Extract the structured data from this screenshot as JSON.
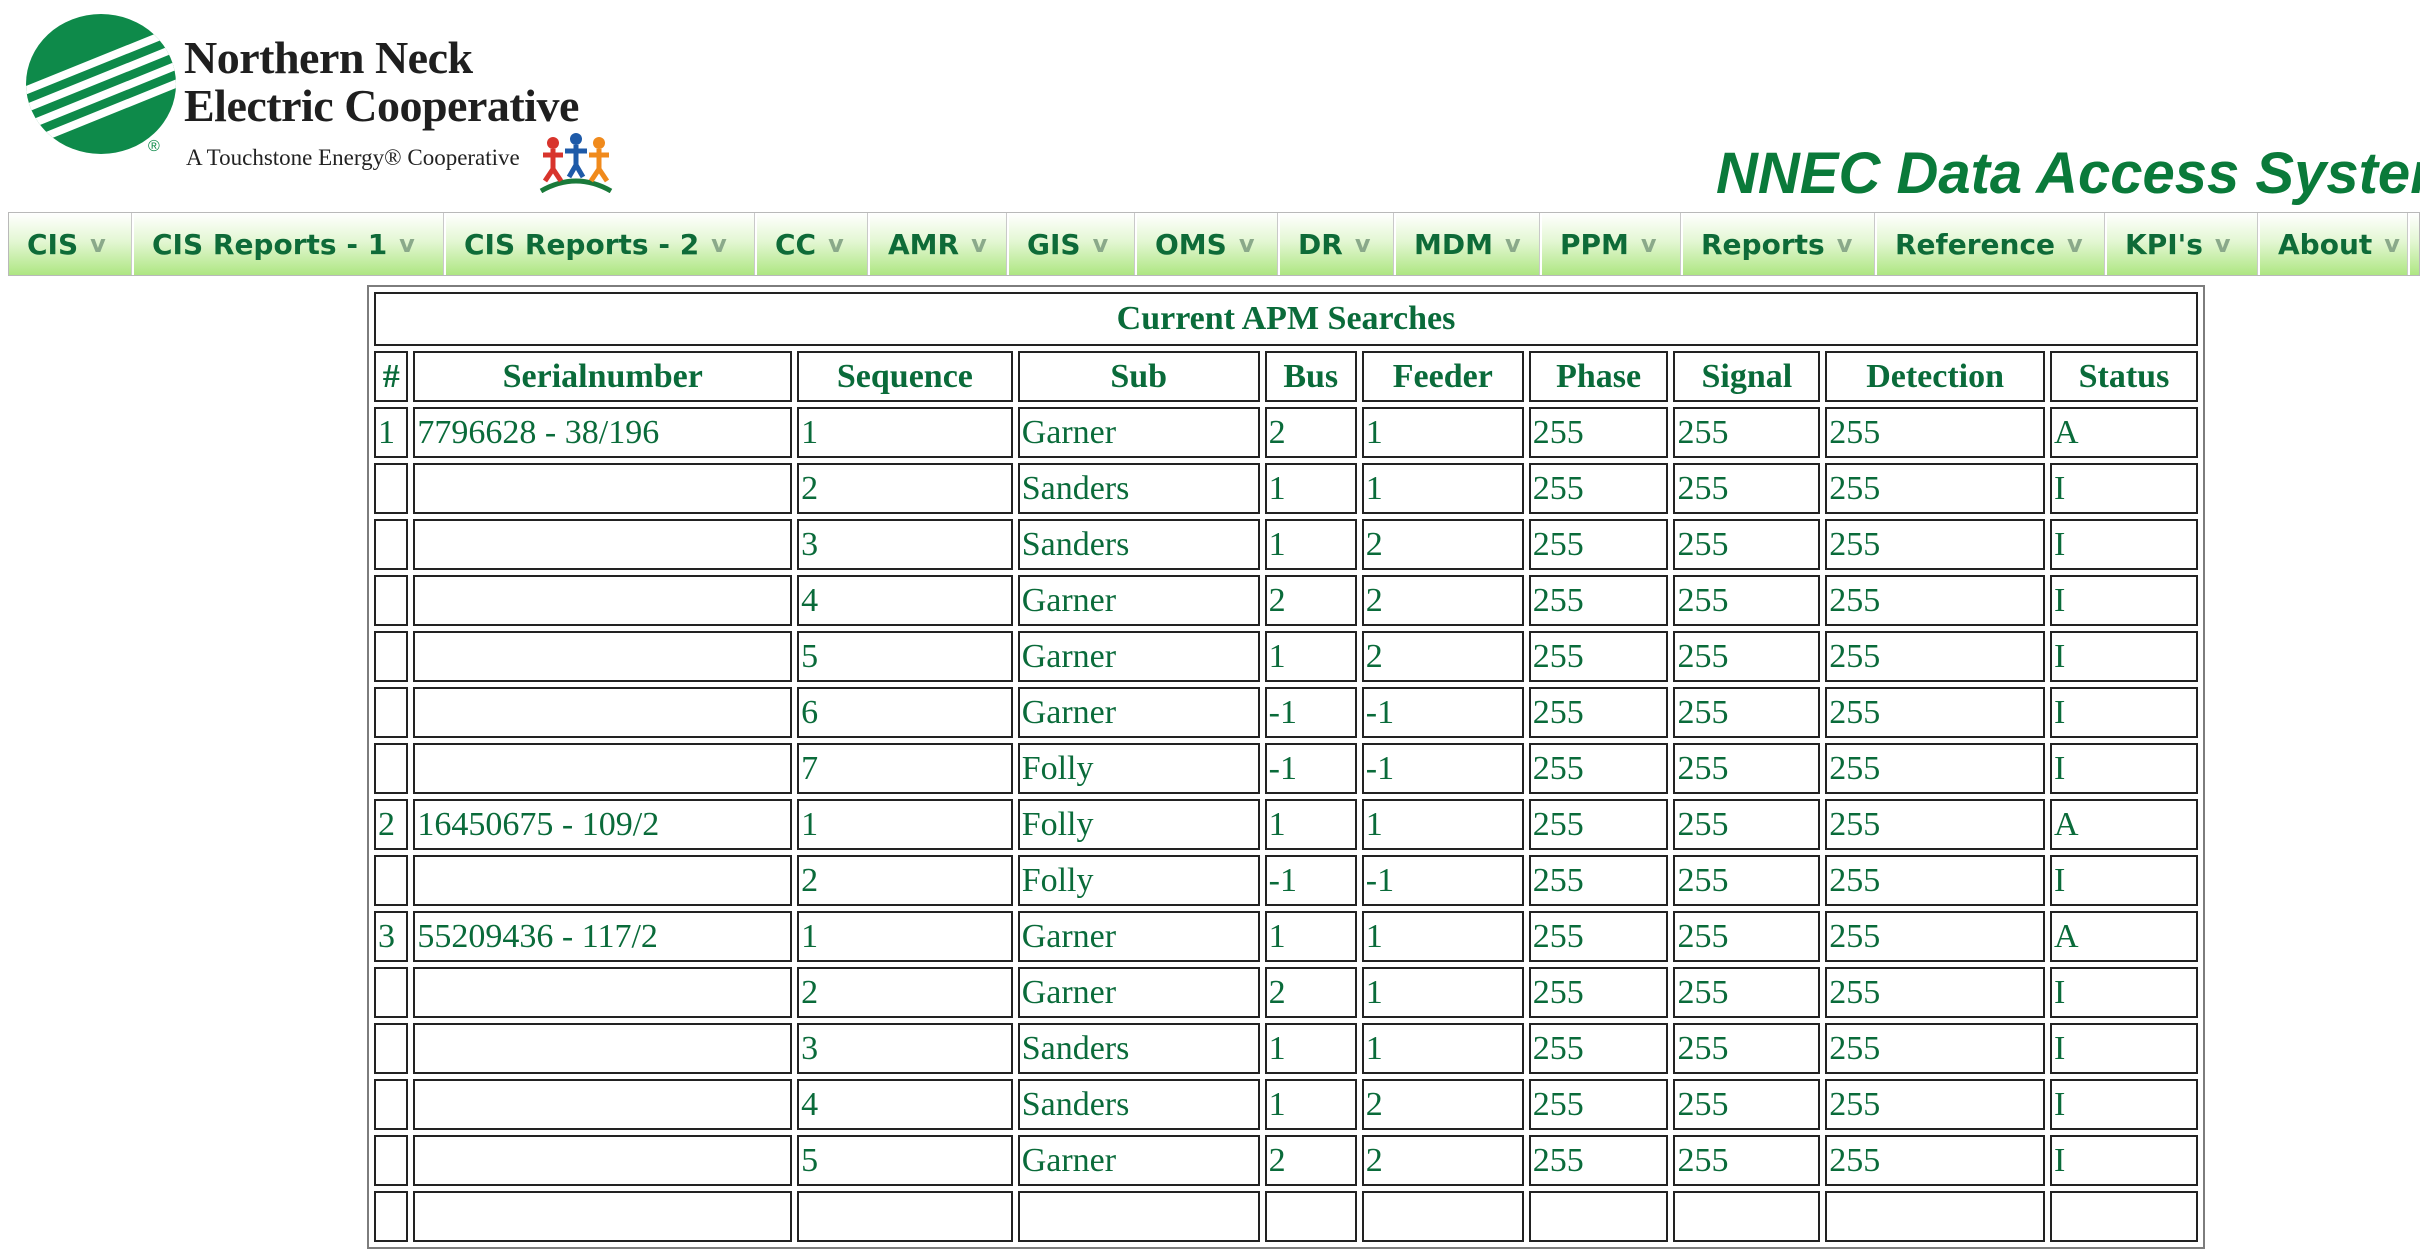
{
  "logo": {
    "name_line1": "Northern Neck",
    "name_line2": "Electric Cooperative",
    "tagline": "A Touchstone Energy® Cooperative",
    "registered_mark": "®",
    "brand_color": "#0e8a4a"
  },
  "app_title": "NNEC Data Access System",
  "menu": {
    "items": [
      {
        "label": "CIS",
        "caret": "v"
      },
      {
        "label": "CIS Reports - 1",
        "caret": "v"
      },
      {
        "label": "CIS Reports - 2",
        "caret": "v"
      },
      {
        "label": "CC",
        "caret": "v"
      },
      {
        "label": "AMR",
        "caret": "v"
      },
      {
        "label": "GIS",
        "caret": "v"
      },
      {
        "label": "OMS",
        "caret": "v"
      },
      {
        "label": "DR",
        "caret": "v"
      },
      {
        "label": "MDM",
        "caret": "v"
      },
      {
        "label": "PPM",
        "caret": "v"
      },
      {
        "label": "Reports",
        "caret": "v"
      },
      {
        "label": "Reference",
        "caret": "v"
      },
      {
        "label": "KPI's",
        "caret": "v"
      },
      {
        "label": "About",
        "caret": "v"
      }
    ]
  },
  "table": {
    "title": "Current APM Searches",
    "columns": [
      "#",
      "Serialnumber",
      "Sequence",
      "Sub",
      "Bus",
      "Feeder",
      "Phase",
      "Signal",
      "Detection",
      "Status"
    ],
    "rows": [
      [
        "1",
        "7796628 - 38/196",
        "1",
        "Garner",
        "2",
        "1",
        "255",
        "255",
        "255",
        "A"
      ],
      [
        "",
        "",
        "2",
        "Sanders",
        "1",
        "1",
        "255",
        "255",
        "255",
        "I"
      ],
      [
        "",
        "",
        "3",
        "Sanders",
        "1",
        "2",
        "255",
        "255",
        "255",
        "I"
      ],
      [
        "",
        "",
        "4",
        "Garner",
        "2",
        "2",
        "255",
        "255",
        "255",
        "I"
      ],
      [
        "",
        "",
        "5",
        "Garner",
        "1",
        "2",
        "255",
        "255",
        "255",
        "I"
      ],
      [
        "",
        "",
        "6",
        "Garner",
        "-1",
        "-1",
        "255",
        "255",
        "255",
        "I"
      ],
      [
        "",
        "",
        "7",
        "Folly",
        "-1",
        "-1",
        "255",
        "255",
        "255",
        "I"
      ],
      [
        "2",
        "16450675 - 109/2",
        "1",
        "Folly",
        "1",
        "1",
        "255",
        "255",
        "255",
        "A"
      ],
      [
        "",
        "",
        "2",
        "Folly",
        "-1",
        "-1",
        "255",
        "255",
        "255",
        "I"
      ],
      [
        "3",
        "55209436 - 117/2",
        "1",
        "Garner",
        "1",
        "1",
        "255",
        "255",
        "255",
        "A"
      ],
      [
        "",
        "",
        "2",
        "Garner",
        "2",
        "1",
        "255",
        "255",
        "255",
        "I"
      ],
      [
        "",
        "",
        "3",
        "Sanders",
        "1",
        "1",
        "255",
        "255",
        "255",
        "I"
      ],
      [
        "",
        "",
        "4",
        "Sanders",
        "1",
        "2",
        "255",
        "255",
        "255",
        "I"
      ],
      [
        "",
        "",
        "5",
        "Garner",
        "2",
        "2",
        "255",
        "255",
        "255",
        "I"
      ],
      [
        "",
        "",
        "",
        "",
        "",
        "",
        "",
        "",
        "",
        ""
      ]
    ]
  },
  "colors": {
    "text_green": "#0a6b3a",
    "title_green": "#0a7a3a",
    "menu_gradient_bottom": "#aee682"
  }
}
